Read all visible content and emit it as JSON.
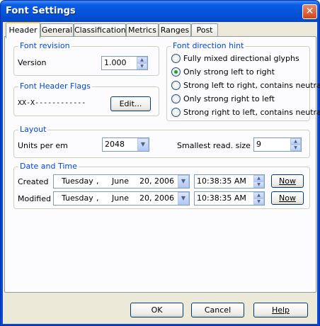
{
  "window": {
    "title": "Font Settings",
    "close_glyph": "✕"
  },
  "tabs": [
    "Header",
    "General",
    "Classification",
    "Metrics",
    "Ranges",
    "Post"
  ],
  "font_revision": {
    "title": "Font revision",
    "version_label": "Version",
    "version_value": "1.000"
  },
  "font_direction": {
    "title": "Font direction hint",
    "options": [
      "Fully mixed directional glyphs",
      "Only strong left to right",
      "Strong left to right, contains neutrals",
      "Only strong right to left",
      "Strong right to left, contains neutrals"
    ],
    "selected_index": 1
  },
  "font_header_flags": {
    "title": "Font Header Flags",
    "flags_value": "XX-X------------",
    "edit_label": "Edit..."
  },
  "layout": {
    "title": "Layout",
    "units_label": "Units per em",
    "units_value": "2048",
    "smallest_label": "Smallest read. size",
    "smallest_value": "9"
  },
  "date_time": {
    "title": "Date and Time",
    "created_label": "Created",
    "created_day": "Tuesday",
    "created_sep": ",",
    "created_month": "June",
    "created_date": "20, 2006",
    "created_time": "10:38:35 AM",
    "modified_label": "Modified",
    "modified_day": "Tuesday",
    "modified_sep": ",",
    "modified_month": "June",
    "modified_date": "20, 2006",
    "modified_time": "10:38:35 AM",
    "now_label": "Now"
  },
  "footer": {
    "ok_label": "OK",
    "cancel_label": "Cancel",
    "help_label": "Help"
  },
  "colors": {
    "titlebar": "#0a5ce6",
    "group_label": "#0046d5",
    "dialog_bg": "#ece9d8"
  }
}
